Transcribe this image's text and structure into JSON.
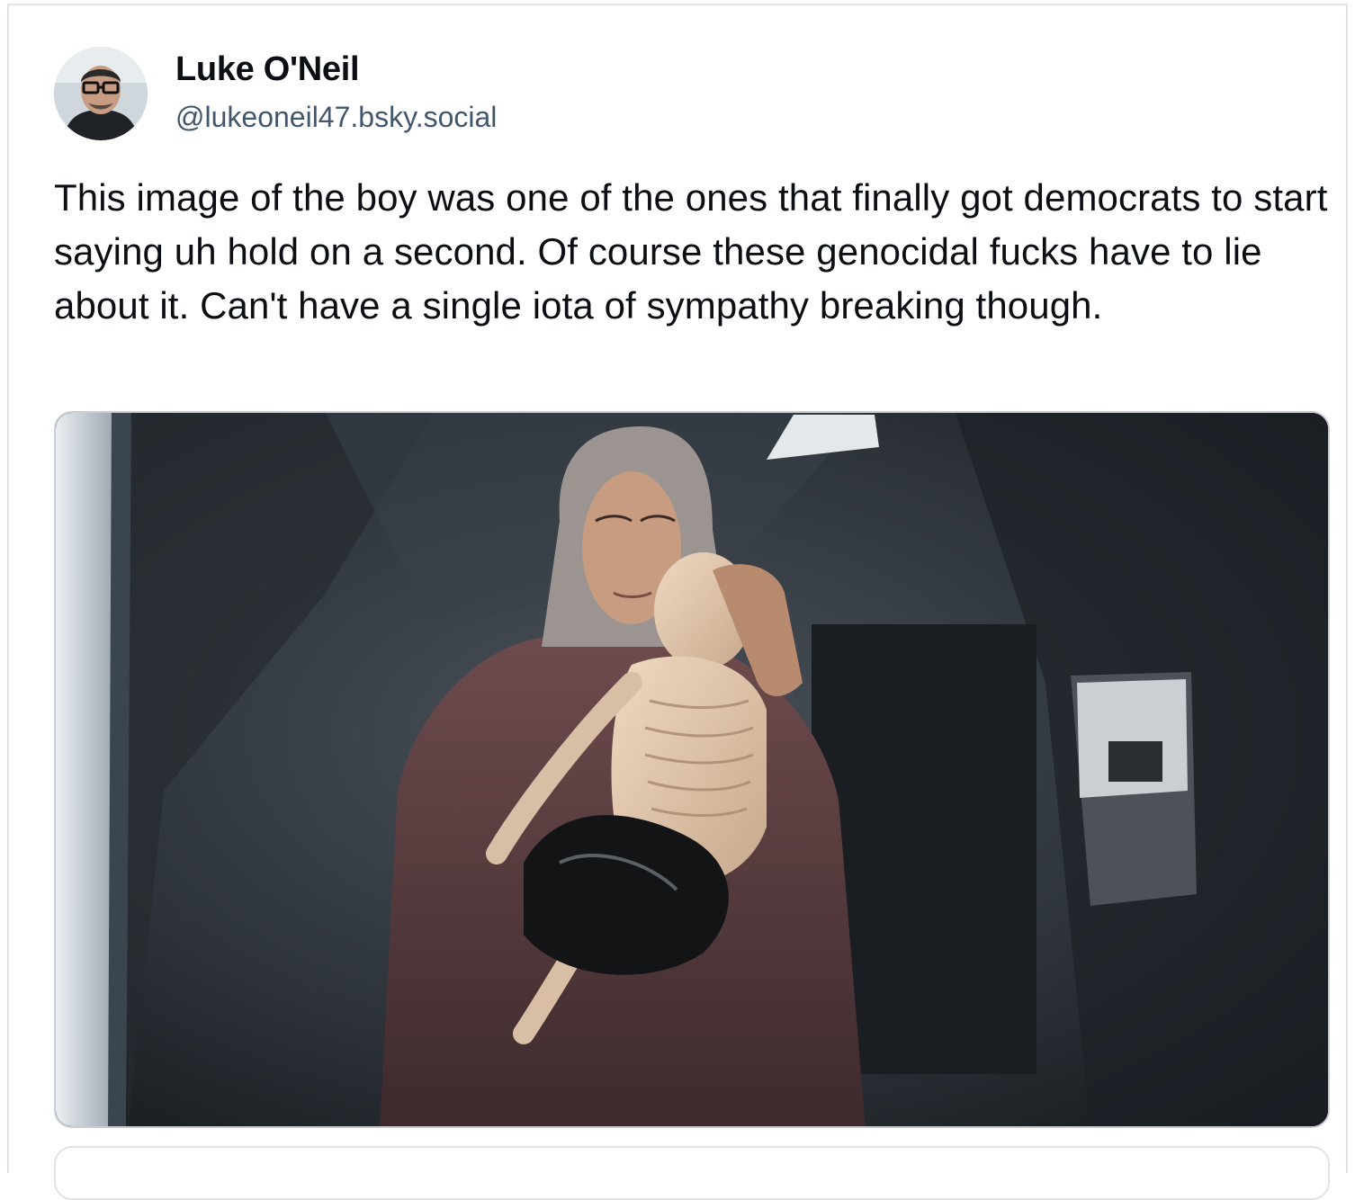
{
  "post": {
    "author": {
      "display_name": "Luke O'Neil",
      "handle": "@lukeoneil47.bsky.social"
    },
    "text": "This image of the boy was one of the ones that finally got democrats to start saying uh hold on a second. Of course these genocidal fucks have to lie about it. Can't have a single iota of sympathy breaking though."
  },
  "colors": {
    "text_primary": "#0b0f14",
    "text_secondary": "#42576c",
    "border": "#dfe3e7"
  }
}
